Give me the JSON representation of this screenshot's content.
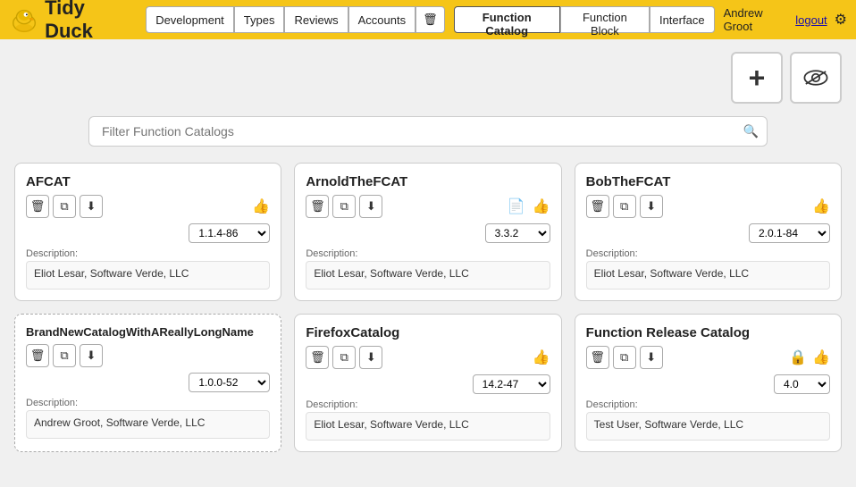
{
  "header": {
    "logo_text": "Tidy Duck",
    "nav_group1": [
      {
        "label": "Development",
        "active": false
      },
      {
        "label": "Types",
        "active": false
      },
      {
        "label": "Reviews",
        "active": false
      },
      {
        "label": "Accounts",
        "active": false
      },
      {
        "label": "🗑",
        "active": false,
        "icon": true
      }
    ],
    "nav_group2": [
      {
        "label": "Function Catalog",
        "active": true
      },
      {
        "label": "Function Block",
        "active": false
      },
      {
        "label": "Interface",
        "active": false
      }
    ],
    "user_name": "Andrew Groot",
    "logout_label": "logout"
  },
  "toolbar": {
    "add_label": "+",
    "eye_title": "eye-toggle"
  },
  "filter": {
    "placeholder": "Filter Function Catalogs",
    "value": ""
  },
  "catalogs": [
    {
      "id": "afcat",
      "name": "AFCAT",
      "dashed": false,
      "version": "1.1.4-86",
      "desc_label": "Description:",
      "desc_value": "Eliot Lesar, Software Verde, LLC",
      "has_thumb": false,
      "has_lock": false
    },
    {
      "id": "arnoldfcat",
      "name": "ArnoldTheFCAT",
      "dashed": false,
      "version": "3.3.2",
      "desc_label": "Description:",
      "desc_value": "Eliot Lesar, Software Verde, LLC",
      "has_thumb": true,
      "has_lock": false
    },
    {
      "id": "bobfcat",
      "name": "BobTheFCAT",
      "dashed": false,
      "version": "2.0.1-84",
      "desc_label": "Description:",
      "desc_value": "Eliot Lesar, Software Verde, LLC",
      "has_thumb": false,
      "has_lock": false
    },
    {
      "id": "brandnew",
      "name": "BrandNewCatalogWithAReallyLongName",
      "dashed": true,
      "version": "1.0.0-52",
      "desc_label": "Description:",
      "desc_value": "Andrew Groot, Software Verde, LLC",
      "has_thumb": false,
      "has_lock": false
    },
    {
      "id": "firefox",
      "name": "FirefoxCatalog",
      "dashed": false,
      "version": "14.2-47",
      "desc_label": "Description:",
      "desc_value": "Eliot Lesar, Software Verde, LLC",
      "has_thumb": false,
      "has_lock": false
    },
    {
      "id": "functionrelease",
      "name": "Function Release Catalog",
      "dashed": false,
      "version": "4.0",
      "desc_label": "Description:",
      "desc_value": "Test User, Software Verde, LLC",
      "has_thumb": true,
      "has_lock": true
    }
  ],
  "icons": {
    "trash": "🗑",
    "copy": "⧉",
    "download": "⬇",
    "like": "👍",
    "thumb": "📄",
    "lock": "🔒",
    "search": "🔍",
    "gear": "⚙"
  }
}
